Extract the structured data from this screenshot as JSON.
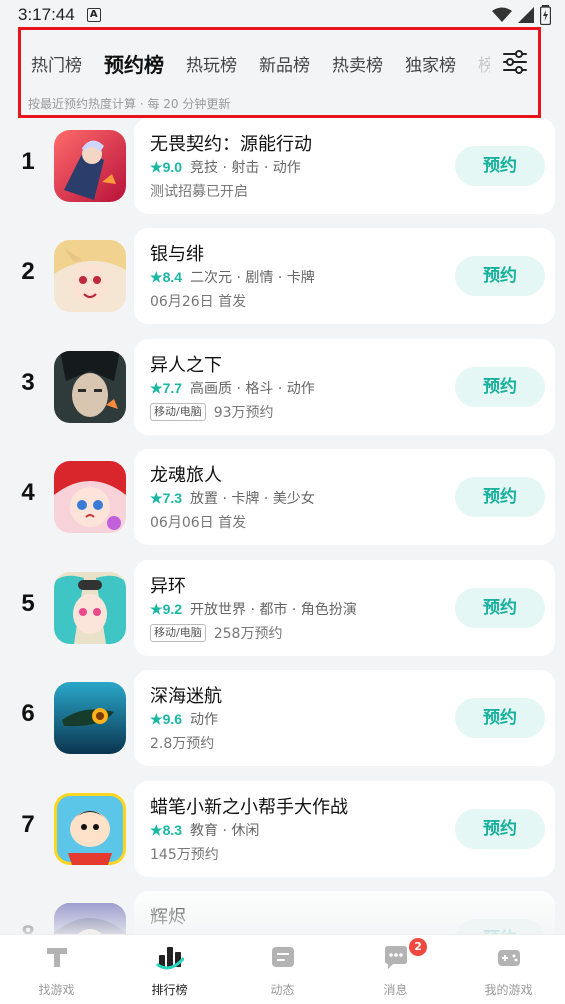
{
  "status_bar": {
    "time": "3:17:44",
    "a_icon": "A"
  },
  "tabs": {
    "items": [
      {
        "label": "热门榜",
        "active": false
      },
      {
        "label": "预约榜",
        "active": true
      },
      {
        "label": "热玩榜",
        "active": false
      },
      {
        "label": "新品榜",
        "active": false
      },
      {
        "label": "热卖榜",
        "active": false
      },
      {
        "label": "独家榜",
        "active": false
      },
      {
        "label": "榜",
        "active": false
      }
    ],
    "note": "按最近预约热度计算 · 每 20 分钟更新",
    "filter_icon": "filter-sliders-icon"
  },
  "games": [
    {
      "rank": "1",
      "title": "无畏契约：源能行动",
      "score": "9.0",
      "tags": "竞技 · 射击 · 动作",
      "platform": "",
      "sub": "测试招募已开启",
      "button": "预约"
    },
    {
      "rank": "2",
      "title": "银与绯",
      "score": "8.4",
      "tags": "二次元 · 剧情 · 卡牌",
      "platform": "",
      "sub": "06月26日 首发",
      "button": "预约"
    },
    {
      "rank": "3",
      "title": "异人之下",
      "score": "7.7",
      "tags": "高画质 · 格斗 · 动作",
      "platform": "移动/电脑",
      "sub": "93万预约",
      "button": "预约"
    },
    {
      "rank": "4",
      "title": "龙魂旅人",
      "score": "7.3",
      "tags": "放置 · 卡牌 · 美少女",
      "platform": "",
      "sub": "06月06日 首发",
      "button": "预约"
    },
    {
      "rank": "5",
      "title": "异环",
      "score": "9.2",
      "tags": "开放世界 · 都市 · 角色扮演",
      "platform": "移动/电脑",
      "sub": "258万预约",
      "button": "预约"
    },
    {
      "rank": "6",
      "title": "深海迷航",
      "score": "9.6",
      "tags": "动作",
      "platform": "",
      "sub": "2.8万预约",
      "button": "预约"
    },
    {
      "rank": "7",
      "title": "蜡笔小新之小帮手大作战",
      "score": "8.3",
      "tags": "教育 · 休闲",
      "platform": "",
      "sub": "145万预约",
      "button": "预约"
    },
    {
      "rank": "8",
      "title": "辉烬",
      "score": "",
      "tags": "",
      "platform": "",
      "sub": "",
      "button": "预约"
    }
  ],
  "bottom_nav": [
    {
      "label": "找游戏",
      "icon": "find-game-icon",
      "active": false
    },
    {
      "label": "排行榜",
      "icon": "ranking-icon",
      "active": true
    },
    {
      "label": "动态",
      "icon": "feed-icon",
      "active": false
    },
    {
      "label": "消息",
      "icon": "message-icon",
      "active": false,
      "badge": "2"
    },
    {
      "label": "我的游戏",
      "icon": "my-games-icon",
      "active": false
    }
  ],
  "colors": {
    "accent": "#2ad4bd",
    "button_bg": "#e4f7f4",
    "button_text": "#18b19d",
    "highlight_border": "#e8141b",
    "badge": "#f0473f"
  }
}
